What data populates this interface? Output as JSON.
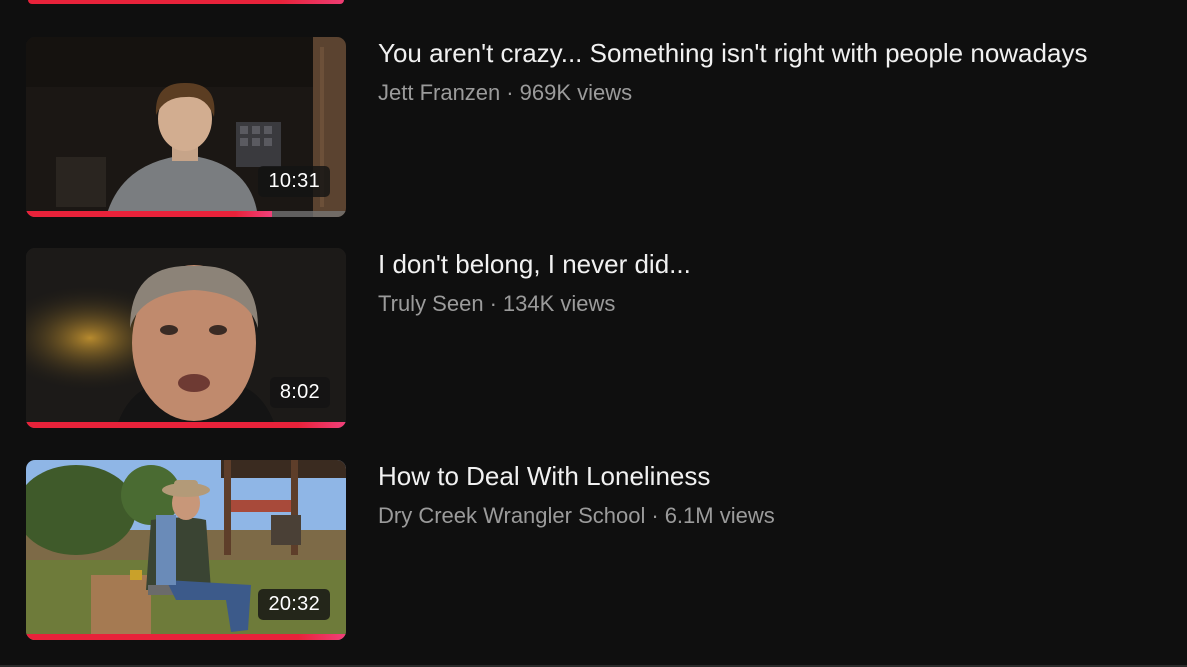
{
  "videos": [
    {
      "title": "You aren't crazy... Something isn't right with people nowadays",
      "channel": "Jett Franzen",
      "views": "969K views",
      "duration": "10:31",
      "watched_fraction": 0.77,
      "thumbnail_icon": "thumbnail-man-dark-room"
    },
    {
      "title": "I don't belong, I never did...",
      "channel": "Truly Seen",
      "views": "134K views",
      "duration": "8:02",
      "watched_fraction": 1.0,
      "thumbnail_icon": "thumbnail-man-portrait"
    },
    {
      "title": "How to Deal With Loneliness",
      "channel": "Dry Creek Wrangler School",
      "views": "6.1M views",
      "duration": "20:32",
      "watched_fraction": 1.0,
      "thumbnail_icon": "thumbnail-cowboy-outdoors"
    }
  ],
  "separator": "·",
  "colors": {
    "background": "#0f0f0f",
    "progress": "#e8223a",
    "title": "#f1f1f1",
    "secondary": "#9b9b9b"
  }
}
